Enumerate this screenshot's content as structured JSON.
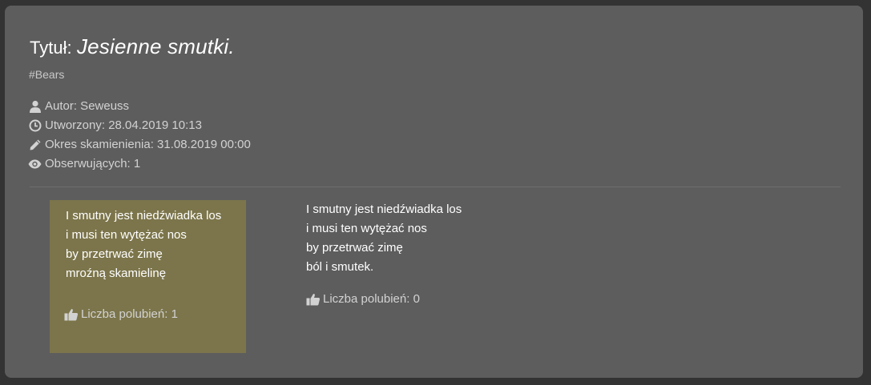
{
  "post": {
    "title_prefix": "Tytuł:",
    "title_name": "Jesienne smutki.",
    "tag": "#Bears",
    "meta": {
      "author": "Autor: Seweuss",
      "created": "Utworzony: 28.04.2019 10:13",
      "fossilization": "Okres skamienienia: 31.08.2019 00:00",
      "watchers": "Obserwujących: 1"
    }
  },
  "entries": [
    {
      "highlighted": true,
      "background": "#7c754b",
      "lines": [
        "I smutny jest niedźwiadka los",
        "i musi ten wytężać nos",
        "by przetrwać zimę",
        "mroźną skamielinę"
      ],
      "likes_label": "Liczba polubień: 1"
    },
    {
      "highlighted": false,
      "lines": [
        "I smutny jest niedźwiadka los",
        "i musi ten wytężać nos",
        "by przetrwać zimę",
        "ból i smutek."
      ],
      "likes_label": "Liczba polubień: 0"
    }
  ],
  "icons": {
    "author": "user-icon",
    "created": "clock-icon",
    "fossilization": "pencil-icon",
    "watchers": "eye-icon",
    "likes": "thumbs-up-icon"
  },
  "colors": {
    "page_background": "#333333",
    "card_background": "#5d5d5d",
    "text_primary": "#ffffff",
    "text_secondary": "#d2d2d2"
  }
}
